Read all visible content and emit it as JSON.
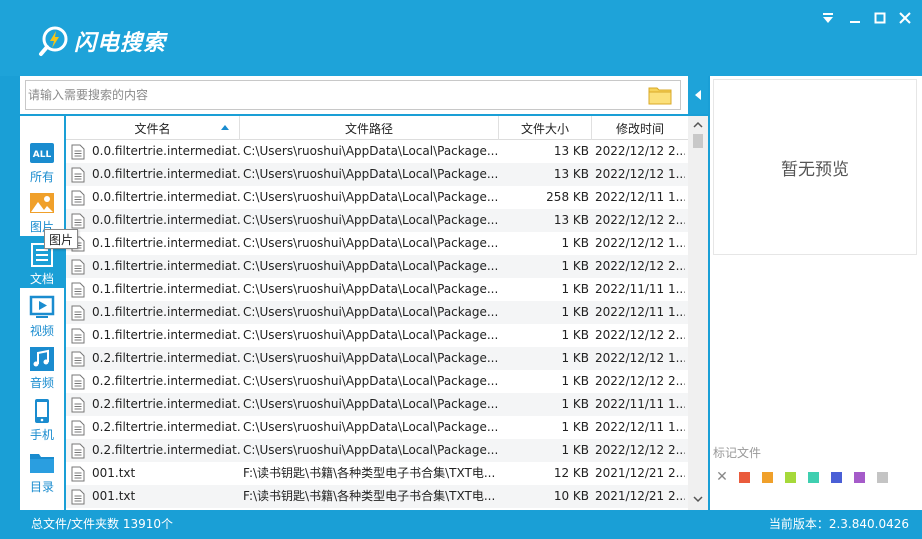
{
  "app": {
    "title": "闪电搜索",
    "version_label": "当前版本：2.3.840.0426"
  },
  "search": {
    "placeholder": "请输入需要搜索的内容",
    "value": ""
  },
  "sidebar": {
    "categories": [
      {
        "label": "所有",
        "icon": "all-icon"
      },
      {
        "label": "图片",
        "icon": "image-icon"
      },
      {
        "label": "文档",
        "icon": "document-icon",
        "active": true
      },
      {
        "label": "视频",
        "icon": "video-icon"
      },
      {
        "label": "音频",
        "icon": "music-icon"
      },
      {
        "label": "手机",
        "icon": "phone-icon"
      },
      {
        "label": "目录",
        "icon": "folder-icon"
      }
    ],
    "tooltip": "图片"
  },
  "table": {
    "columns": [
      "文件名",
      "文件路径",
      "文件大小",
      "修改时间"
    ],
    "rows": [
      [
        "0.0.filtertrie.intermediat...",
        "C:\\Users\\ruoshui\\AppData\\Local\\Package...",
        "13 KB",
        "2022/12/12 2..."
      ],
      [
        "0.0.filtertrie.intermediat...",
        "C:\\Users\\ruoshui\\AppData\\Local\\Package...",
        "13 KB",
        "2022/12/12 1..."
      ],
      [
        "0.0.filtertrie.intermediat...",
        "C:\\Users\\ruoshui\\AppData\\Local\\Package...",
        "258 KB",
        "2022/12/11 1..."
      ],
      [
        "0.0.filtertrie.intermediat...",
        "C:\\Users\\ruoshui\\AppData\\Local\\Package...",
        "13 KB",
        "2022/12/12 2..."
      ],
      [
        "0.1.filtertrie.intermediat...",
        "C:\\Users\\ruoshui\\AppData\\Local\\Package...",
        "1 KB",
        "2022/12/12 1..."
      ],
      [
        "0.1.filtertrie.intermediat...",
        "C:\\Users\\ruoshui\\AppData\\Local\\Package...",
        "1 KB",
        "2022/12/12 2..."
      ],
      [
        "0.1.filtertrie.intermediat...",
        "C:\\Users\\ruoshui\\AppData\\Local\\Package...",
        "1 KB",
        "2022/11/11 1..."
      ],
      [
        "0.1.filtertrie.intermediat...",
        "C:\\Users\\ruoshui\\AppData\\Local\\Package...",
        "1 KB",
        "2022/12/11 1..."
      ],
      [
        "0.1.filtertrie.intermediat...",
        "C:\\Users\\ruoshui\\AppData\\Local\\Package...",
        "1 KB",
        "2022/12/12 2..."
      ],
      [
        "0.2.filtertrie.intermediat...",
        "C:\\Users\\ruoshui\\AppData\\Local\\Package...",
        "1 KB",
        "2022/12/12 1..."
      ],
      [
        "0.2.filtertrie.intermediat...",
        "C:\\Users\\ruoshui\\AppData\\Local\\Package...",
        "1 KB",
        "2022/12/12 2..."
      ],
      [
        "0.2.filtertrie.intermediat...",
        "C:\\Users\\ruoshui\\AppData\\Local\\Package...",
        "1 KB",
        "2022/11/11 1..."
      ],
      [
        "0.2.filtertrie.intermediat...",
        "C:\\Users\\ruoshui\\AppData\\Local\\Package...",
        "1 KB",
        "2022/12/11 1..."
      ],
      [
        "0.2.filtertrie.intermediat...",
        "C:\\Users\\ruoshui\\AppData\\Local\\Package...",
        "1 KB",
        "2022/12/12 2..."
      ],
      [
        "001.txt",
        "F:\\读书钥匙\\书籍\\各种类型电子书合集\\TXT电...",
        "12 KB",
        "2021/12/21 2..."
      ],
      [
        "001.txt",
        "F:\\读书钥匙\\书籍\\各种类型电子书合集\\TXT电...",
        "10 KB",
        "2021/12/21 2..."
      ]
    ]
  },
  "preview": {
    "empty_text": "暂无预览",
    "mark_title": "标记文件",
    "mark_colors": [
      "#ea5b3c",
      "#f0a02a",
      "#a6d93a",
      "#3fcfb0",
      "#4a5fd6",
      "#a55bc9",
      "#c4c4c4"
    ]
  },
  "status": {
    "total_label": "总文件/文件夹数 13910个"
  },
  "colors": {
    "accent": "#1a9fd6",
    "icon_blue": "#1a8ccf"
  }
}
